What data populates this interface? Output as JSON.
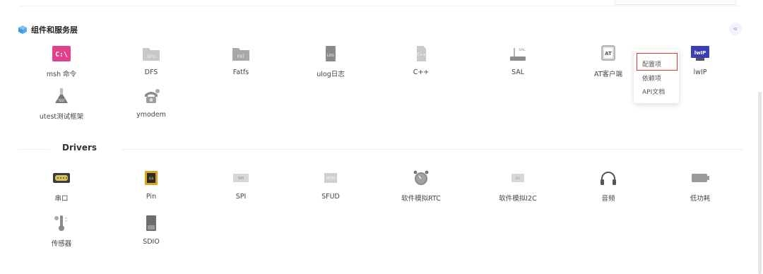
{
  "section1": {
    "title": "组件和服务层",
    "collapse_icon": "«",
    "items": [
      {
        "label": "msh 命令",
        "icon": "terminal-icon"
      },
      {
        "label": "DFS",
        "icon": "folder-icon"
      },
      {
        "label": "Fatfs",
        "icon": "fat-folder-icon"
      },
      {
        "label": "ulog日志",
        "icon": "log-icon"
      },
      {
        "label": "C++",
        "icon": "cpp-file-icon"
      },
      {
        "label": "SAL",
        "icon": "network-icon"
      },
      {
        "label": "AT客户端",
        "icon": "at-icon"
      },
      {
        "label": "lwIP",
        "icon": "lwip-icon"
      },
      {
        "label": "utest测试框架",
        "icon": "flask-icon"
      },
      {
        "label": "ymodem",
        "icon": "phone-icon"
      }
    ]
  },
  "section2": {
    "title": "Drivers",
    "items": [
      {
        "label": "串口",
        "icon": "serial-port-icon"
      },
      {
        "label": "Pin",
        "icon": "chip-icon"
      },
      {
        "label": "SPI",
        "icon": "spi-icon"
      },
      {
        "label": "SFUD",
        "icon": "sfud-icon"
      },
      {
        "label": "软件模拟RTC",
        "icon": "clock-icon"
      },
      {
        "label": "软件模拟I2C",
        "icon": "i2c-icon"
      },
      {
        "label": "音频",
        "icon": "headphones-icon"
      },
      {
        "label": "低功耗",
        "icon": "battery-icon"
      },
      {
        "label": "传感器",
        "icon": "thermometer-icon"
      },
      {
        "label": "SDIO",
        "icon": "sd-card-icon"
      }
    ]
  },
  "icon_text": {
    "msh": "C:\\",
    "dfs": "DFS",
    "fat": "FAT",
    "log": "LOG",
    "cpp": "C++",
    "sal": "SAL",
    "at": "AT",
    "lwip": "lwIP",
    "test": "TEST",
    "pin": "64",
    "spi": "SPI",
    "sfud": "SFUD",
    "i2c": "I2C"
  },
  "context_menu": {
    "items": [
      "配置项",
      "依赖项",
      "API文档"
    ],
    "highlight_color": "#d0333a"
  },
  "colors": {
    "accent": "#5aa9e6",
    "msh_icon": "#e0418a",
    "lwip_icon": "#3a3fb8"
  }
}
